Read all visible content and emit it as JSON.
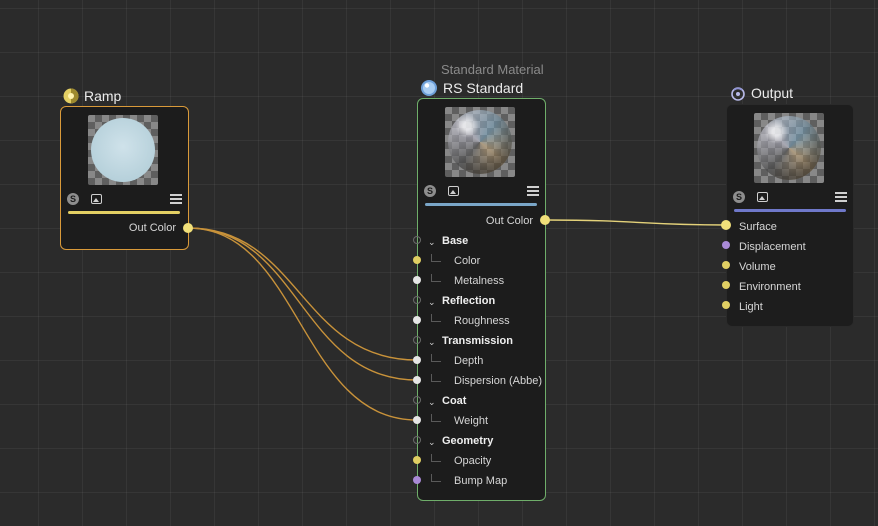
{
  "canvas": {
    "background": "#2b2b2b"
  },
  "colors": {
    "ramp_border": "#d99a3a",
    "rs_border": "#6fae6a",
    "wire": "#c8923a",
    "wire_output": "#e4d27a",
    "port_yellow": "#e0cf63",
    "port_white": "#e6e6e6",
    "port_purple": "#a98ad6",
    "ramp_bar": "#e3cf63",
    "rs_bar": "#7aa6c8",
    "output_bar": "#6f78c9"
  },
  "nodes": {
    "ramp": {
      "title": "Ramp",
      "icon": "ramp-icon",
      "toolbar": {
        "s_label": "S"
      },
      "out_port": "Out Color"
    },
    "rs_standard": {
      "subtitle": "Standard Material",
      "title": "RS Standard",
      "icon": "material-sphere-icon",
      "toolbar": {
        "s_label": "S"
      },
      "out_port": "Out Color",
      "groups": [
        {
          "label": "Base",
          "ports": [
            "Color",
            "Metalness"
          ]
        },
        {
          "label": "Reflection",
          "ports": [
            "Roughness"
          ]
        },
        {
          "label": "Transmission",
          "ports": [
            "Depth",
            "Dispersion (Abbe)"
          ]
        },
        {
          "label": "Coat",
          "ports": [
            "Weight"
          ]
        },
        {
          "label": "Geometry",
          "ports": [
            "Opacity",
            "Bump Map"
          ]
        }
      ]
    },
    "output": {
      "title": "Output",
      "icon": "output-icon",
      "toolbar": {
        "s_label": "S"
      },
      "in_ports": [
        "Surface",
        "Displacement",
        "Volume",
        "Environment",
        "Light"
      ]
    }
  }
}
